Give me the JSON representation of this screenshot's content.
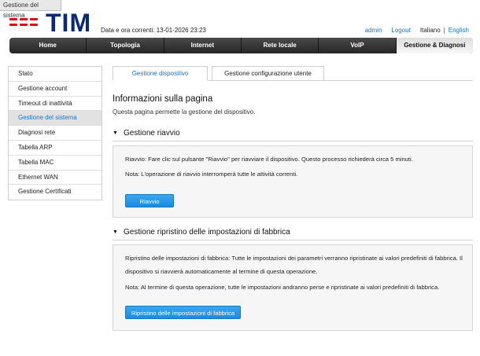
{
  "window": {
    "tab_label": "Gestione del sistema"
  },
  "brand": {
    "name": "TIM",
    "mark_color": "#e30613",
    "text_color": "#0a2a78"
  },
  "header": {
    "datetime": "Data e ora correnti: 13-01-2026 23:23",
    "admin_link": "admin",
    "logout_link": "Logout",
    "lang_current": "Italiano",
    "lang_sep": "|",
    "lang_other": "English"
  },
  "nav": {
    "items": [
      {
        "label": "Home"
      },
      {
        "label": "Topologia"
      },
      {
        "label": "Internet"
      },
      {
        "label": "Rete locale"
      },
      {
        "label": "VoIP"
      },
      {
        "label": "Gestione & Diagnosi",
        "active": true
      }
    ]
  },
  "sidebar": {
    "items": [
      {
        "label": "Stato"
      },
      {
        "label": "Gestione account"
      },
      {
        "label": "Timeout di inattività"
      },
      {
        "label": "Gestione del sistema",
        "active": true
      },
      {
        "label": "Diagnosi rete"
      },
      {
        "label": "Tabella ARP"
      },
      {
        "label": "Tabella MAC"
      },
      {
        "label": "Ethernet WAN"
      },
      {
        "label": "Gestione Certificati"
      }
    ]
  },
  "tabs": [
    {
      "label": "Gestione dispositivo",
      "active": true
    },
    {
      "label": "Gestione configurazione utente"
    }
  ],
  "main": {
    "title": "Informazioni sulla pagina",
    "description": "Questa pagina permette la gestione del dispositivo."
  },
  "reboot": {
    "heading": "Gestione riavvio",
    "text": "Riavvio: Fare clic sul pulsante \"Riavvio\" per riavviare il dispositivo. Questo processo richiederà circa 5 minuti.",
    "note": "Nota: L'operazione di riavvio interromperà tutte le attività correnti.",
    "button": "Riavvio"
  },
  "factory": {
    "heading": "Gestione ripristino delle impostazioni di fabbrica",
    "text1": "Ripristino delle impostazioni di fabbrica: Tutte le impostazioni dei parametri verranno ripristinate ai valori predefiniti di fabbrica. Il",
    "text2": "dispositivo si riavvierà automaticamente al termine di questa operazione.",
    "note": "Nota: Al termine di questa operazione, tutte le impostazioni andranno perse e ripristinate ai valori predefiniti di fabbrica.",
    "button": "Ripristino delle impostazioni di fabbrica"
  },
  "colors": {
    "accent": "#1a73c8",
    "button": "#1a8be0",
    "nav_bg": "#262626"
  }
}
